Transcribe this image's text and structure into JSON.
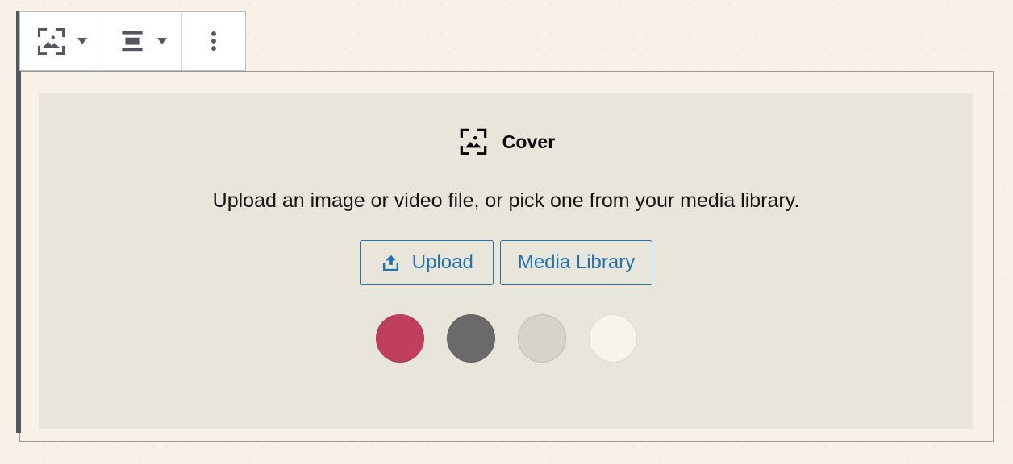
{
  "toolbar": {
    "groups": [
      {
        "name": "block-type",
        "button": {
          "label": "Cover",
          "icon": "cover-block-icon",
          "title": "Cover"
        },
        "dropdown": {
          "icon": "chevron-down-icon",
          "title": "Change block type or style"
        }
      },
      {
        "name": "alignment",
        "button": {
          "label": "Align",
          "icon": "align-full-width-icon",
          "title": "Align"
        },
        "dropdown": {
          "icon": "chevron-down-icon",
          "title": "Change alignment"
        }
      },
      {
        "name": "more-options",
        "button": {
          "label": "Options",
          "icon": "ellipsis-vertical-icon",
          "title": "Options"
        }
      }
    ]
  },
  "placeholder": {
    "icon": "cover-block-icon",
    "label": "Cover",
    "instructions": "Upload an image or video file, or pick one from your media library.",
    "actions": [
      {
        "id": "upload",
        "label": "Upload",
        "icon": "upload-icon"
      },
      {
        "id": "media-library",
        "label": "Media Library",
        "icon": null
      }
    ],
    "colors": {
      "title": "Color swatches",
      "swatches": [
        {
          "name": "crimson",
          "hex": "#bf3f5d"
        },
        {
          "name": "dark-gray",
          "hex": "#6a6a6a"
        },
        {
          "name": "light-gray",
          "hex": "#d6d3c9"
        },
        {
          "name": "off-white",
          "hex": "#f7f4ed"
        }
      ]
    }
  },
  "theme": {
    "canvas_background": "#f7f1e7",
    "placeholder_background": "#e8e5da",
    "block_border": "#9c9b93",
    "selection_bar": "#4f5763",
    "accent_blue": "#2271b1",
    "icon_gray": "#50575e"
  }
}
